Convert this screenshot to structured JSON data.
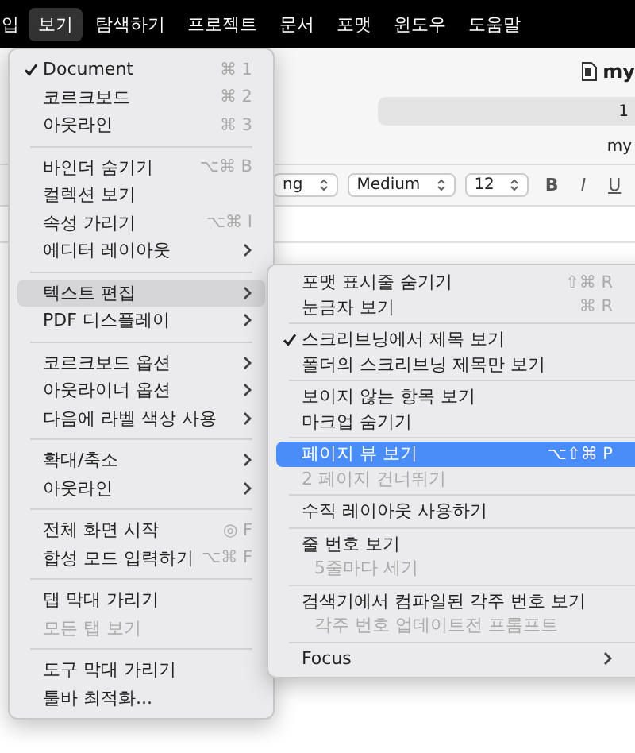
{
  "menubar": [
    {
      "label": "입",
      "selected": false
    },
    {
      "label": "보기",
      "selected": true
    },
    {
      "label": "탐색하기",
      "selected": false
    },
    {
      "label": "프로젝트",
      "selected": false
    },
    {
      "label": "문서",
      "selected": false
    },
    {
      "label": "포맷",
      "selected": false
    },
    {
      "label": "윈도우",
      "selected": false
    },
    {
      "label": "도움말",
      "selected": false
    }
  ],
  "document": {
    "title": "my",
    "field_value": "1",
    "path": "my"
  },
  "format_bar": {
    "dropdowns": [
      "ng",
      "Medium",
      "12"
    ],
    "buttons": [
      {
        "label": "B",
        "kind": "bold"
      },
      {
        "label": "I",
        "kind": "italic"
      },
      {
        "label": "U",
        "kind": "underline"
      }
    ]
  },
  "view_menu": [
    {
      "kind": "item",
      "label": "Document",
      "checked": true,
      "shortcut": "⌘ 1",
      "submenu": false,
      "disabled": false,
      "selected": false
    },
    {
      "kind": "item",
      "label": "코르크보드",
      "checked": false,
      "shortcut": "⌘ 2",
      "submenu": false,
      "disabled": false,
      "selected": false
    },
    {
      "kind": "item",
      "label": "아웃라인",
      "checked": false,
      "shortcut": "⌘ 3",
      "submenu": false,
      "disabled": false,
      "selected": false
    },
    {
      "kind": "separator"
    },
    {
      "kind": "item",
      "label": "바인더 숨기기",
      "checked": false,
      "shortcut": "⌥⌘ B",
      "submenu": false,
      "disabled": false,
      "selected": false
    },
    {
      "kind": "item",
      "label": "컬렉션 보기",
      "checked": false,
      "submenu": false,
      "disabled": false,
      "selected": false
    },
    {
      "kind": "item",
      "label": "속성 가리기",
      "checked": false,
      "shortcut": "⌥⌘ I",
      "submenu": false,
      "disabled": false,
      "selected": false
    },
    {
      "kind": "item",
      "label": "에디터 레이아웃",
      "checked": false,
      "submenu": true,
      "disabled": false,
      "selected": false
    },
    {
      "kind": "separator"
    },
    {
      "kind": "item",
      "label": "텍스트 편집",
      "checked": false,
      "submenu": true,
      "disabled": false,
      "selected": true
    },
    {
      "kind": "item",
      "label": "PDF 디스플레이",
      "checked": false,
      "submenu": true,
      "disabled": false,
      "selected": false
    },
    {
      "kind": "separator"
    },
    {
      "kind": "item",
      "label": "코르크보드 옵션",
      "checked": false,
      "submenu": true,
      "disabled": false,
      "selected": false
    },
    {
      "kind": "item",
      "label": "아웃라이너 옵션",
      "checked": false,
      "submenu": true,
      "disabled": false,
      "selected": false
    },
    {
      "kind": "item",
      "label": "다음에 라벨 색상 사용",
      "checked": false,
      "submenu": true,
      "disabled": false,
      "selected": false
    },
    {
      "kind": "separator"
    },
    {
      "kind": "item",
      "label": "확대/축소",
      "checked": false,
      "submenu": true,
      "disabled": false,
      "selected": false
    },
    {
      "kind": "item",
      "label": "아웃라인",
      "checked": false,
      "submenu": true,
      "disabled": false,
      "selected": false
    },
    {
      "kind": "separator"
    },
    {
      "kind": "item",
      "label": "전체 화면 시작",
      "checked": false,
      "shortcut": "◎ F",
      "submenu": false,
      "disabled": false,
      "selected": false
    },
    {
      "kind": "item",
      "label": "합성 모드 입력하기",
      "checked": false,
      "shortcut": "⌥⌘ F",
      "submenu": false,
      "disabled": false,
      "selected": false
    },
    {
      "kind": "separator"
    },
    {
      "kind": "item",
      "label": "탭 막대 가리기",
      "checked": false,
      "submenu": false,
      "disabled": false,
      "selected": false
    },
    {
      "kind": "item",
      "label": "모든 탭 보기",
      "checked": false,
      "submenu": false,
      "disabled": true,
      "selected": false
    },
    {
      "kind": "separator"
    },
    {
      "kind": "item",
      "label": "도구 막대 가리기",
      "checked": false,
      "submenu": false,
      "disabled": false,
      "selected": false
    },
    {
      "kind": "item",
      "label": "툴바 최적화...",
      "checked": false,
      "submenu": false,
      "disabled": false,
      "selected": false
    }
  ],
  "text_editing_submenu": [
    {
      "kind": "item",
      "label": "포맷 표시줄 숨기기",
      "checked": false,
      "shortcut": "⇧⌘ R",
      "submenu": false,
      "disabled": false,
      "indented": false,
      "selected": false
    },
    {
      "kind": "item",
      "label": "눈금자 보기",
      "checked": false,
      "shortcut": "⌘ R",
      "submenu": false,
      "disabled": false,
      "indented": false,
      "selected": false
    },
    {
      "kind": "separator"
    },
    {
      "kind": "item",
      "label": "스크리브닝에서 제목 보기",
      "checked": true,
      "submenu": false,
      "disabled": false,
      "indented": false,
      "selected": false
    },
    {
      "kind": "item",
      "label": "폴더의 스크리브닝 제목만 보기",
      "checked": false,
      "submenu": false,
      "disabled": false,
      "indented": false,
      "selected": false
    },
    {
      "kind": "separator"
    },
    {
      "kind": "item",
      "label": "보이지 않는 항목 보기",
      "checked": false,
      "submenu": false,
      "disabled": false,
      "indented": false,
      "selected": false
    },
    {
      "kind": "item",
      "label": "마크업 숨기기",
      "checked": false,
      "submenu": false,
      "disabled": false,
      "indented": false,
      "selected": false
    },
    {
      "kind": "separator"
    },
    {
      "kind": "item",
      "label": "페이지 뷰 보기",
      "checked": false,
      "shortcut": "⌥⇧⌘ P",
      "submenu": false,
      "disabled": false,
      "indented": false,
      "selected": true
    },
    {
      "kind": "item",
      "label": "2 페이지 건너뛰기",
      "checked": false,
      "submenu": false,
      "disabled": true,
      "indented": false,
      "selected": false
    },
    {
      "kind": "separator"
    },
    {
      "kind": "item",
      "label": "수직 레이아웃 사용하기",
      "checked": false,
      "submenu": false,
      "disabled": false,
      "indented": false,
      "selected": false
    },
    {
      "kind": "separator"
    },
    {
      "kind": "item",
      "label": "줄 번호 보기",
      "checked": false,
      "submenu": false,
      "disabled": false,
      "indented": false,
      "selected": false
    },
    {
      "kind": "item",
      "label": "5줄마다 세기",
      "checked": false,
      "submenu": false,
      "disabled": true,
      "indented": true,
      "selected": false
    },
    {
      "kind": "separator"
    },
    {
      "kind": "item",
      "label": "검색기에서 컴파일된 각주 번호 보기",
      "checked": false,
      "submenu": false,
      "disabled": false,
      "indented": false,
      "selected": false
    },
    {
      "kind": "item",
      "label": "각주 번호 업데이트전 프롬프트",
      "checked": false,
      "submenu": false,
      "disabled": true,
      "indented": true,
      "selected": false
    },
    {
      "kind": "separator"
    },
    {
      "kind": "item",
      "label": "Focus",
      "checked": false,
      "submenu": true,
      "disabled": false,
      "indented": false,
      "selected": false
    }
  ]
}
